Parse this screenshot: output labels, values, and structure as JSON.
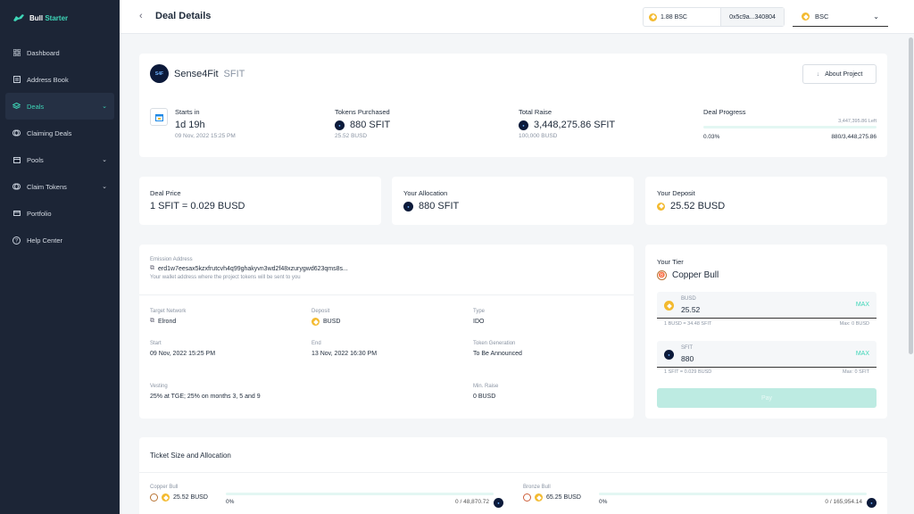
{
  "brand": {
    "name_a": "Bull",
    "name_b": "Starter"
  },
  "sidebar": {
    "items": [
      {
        "label": "Dashboard",
        "icon": "grid-icon"
      },
      {
        "label": "Address Book",
        "icon": "book-icon"
      },
      {
        "label": "Deals",
        "icon": "layers-icon"
      },
      {
        "label": "Claiming Deals",
        "icon": "coins-icon"
      },
      {
        "label": "Pools",
        "icon": "box-icon"
      },
      {
        "label": "Claim Tokens",
        "icon": "coins-icon"
      },
      {
        "label": "Portfolio",
        "icon": "card-icon"
      },
      {
        "label": "Help Center",
        "icon": "help-icon"
      }
    ]
  },
  "header": {
    "title": "Deal Details",
    "balance": "1.88 BSC",
    "address": "0x5c9a...340804",
    "network": "BSC"
  },
  "project": {
    "name": "Sense4Fit",
    "ticker": "SFIT",
    "logo_text": "S4F",
    "about_label": "About Project",
    "starts_label": "Starts in",
    "starts_value": "1d 19h",
    "starts_date": "09 Nov, 2022 15:25 PM",
    "purchased_label": "Tokens Purchased",
    "purchased_value": "880 SFIT",
    "purchased_sub": "25.52 BUSD",
    "raise_label": "Total Raise",
    "raise_value": "3,448,275.86 SFIT",
    "raise_sub": "100,000 BUSD",
    "progress_label": "Deal Progress",
    "progress_left": "3,447,395.86 Left",
    "progress_pct": "0.03%",
    "progress_fraction": 0.0003,
    "progress_ratio": "880/3,448,275.86"
  },
  "price": {
    "label": "Deal Price",
    "value": "1 SFIT = 0.029 BUSD"
  },
  "allocation": {
    "label": "Your Allocation",
    "value": "880 SFIT"
  },
  "deposit": {
    "label": "Your Deposit",
    "value": "25.52 BUSD"
  },
  "details": {
    "emission_label": "Emission Address",
    "emission_value": "erd1w7eesax5kzxfrutcvh4q99ghakyvn3wd2f48xzurygwd623qms8s...",
    "emission_hint": "Your wallet address where the project tokens will be sent to you",
    "network_label": "Target Network",
    "network_value": "Elrond",
    "deposit_label": "Deposit",
    "deposit_value": "BUSD",
    "type_label": "Type",
    "type_value": "IDO",
    "start_label": "Start",
    "start_value": "09 Nov, 2022 15:25 PM",
    "end_label": "End",
    "end_value": "13 Nov, 2022 16:30 PM",
    "tokengen_label": "Token Generation",
    "tokengen_value": "To Be Announced",
    "vesting_label": "Vesting",
    "vesting_value": "25% at TGE; 25% on months 3, 5 and 9",
    "minraise_label": "Min. Raise",
    "minraise_value": "0 BUSD"
  },
  "tier": {
    "label": "Your Tier",
    "value": "Copper Bull",
    "busd_label": "BUSD",
    "busd_value": "25.52",
    "max_label": "MAX",
    "busd_rate": "1 BUSD = 34.48 SFIT",
    "busd_max": "Max: 0 BUSD",
    "sfit_label": "SFIT",
    "sfit_value": "880",
    "sfit_rate": "1 SFIT = 0.029 BUSD",
    "sfit_max": "Max: 0 SFIT",
    "pay_label": "Pay"
  },
  "tickets": {
    "title": "Ticket Size and Allocation",
    "rows": [
      {
        "tier": "Copper Bull",
        "amount": "25.52 BUSD",
        "pct": "0%",
        "fraction": 0,
        "ratio": "0 / 48,870.72"
      },
      {
        "tier": "Bronze Bull",
        "amount": "65.25 BUSD",
        "pct": "0%",
        "fraction": 0,
        "ratio": "0 / 165,954.14"
      }
    ]
  },
  "colors": {
    "accent": "#3ed6b8",
    "sidebar": "#1c2536",
    "busd": "#f3ba2f"
  }
}
